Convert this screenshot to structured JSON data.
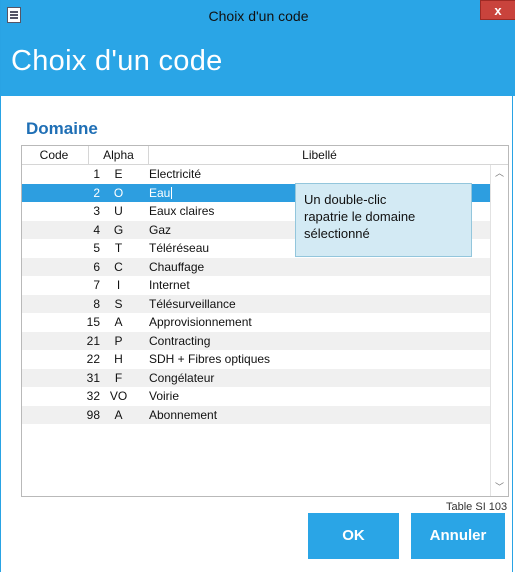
{
  "window": {
    "title": "Choix d'un code",
    "close_label": "x"
  },
  "header": {
    "title": "Choix d'un code"
  },
  "section": {
    "title": "Domaine"
  },
  "table": {
    "columns": [
      "Code",
      "Alpha",
      "Libellé"
    ],
    "selected_index": 1,
    "rows": [
      {
        "code": "1",
        "alpha": "E",
        "libelle": "Electricité"
      },
      {
        "code": "2",
        "alpha": "O",
        "libelle": "Eau"
      },
      {
        "code": "3",
        "alpha": "U",
        "libelle": "Eaux claires"
      },
      {
        "code": "4",
        "alpha": "G",
        "libelle": "Gaz"
      },
      {
        "code": "5",
        "alpha": "T",
        "libelle": "Téléréseau"
      },
      {
        "code": "6",
        "alpha": "C",
        "libelle": "Chauffage"
      },
      {
        "code": "7",
        "alpha": "I",
        "libelle": "Internet"
      },
      {
        "code": "8",
        "alpha": "S",
        "libelle": "Télésurveillance"
      },
      {
        "code": "15",
        "alpha": "A",
        "libelle": "Approvisionnement"
      },
      {
        "code": "21",
        "alpha": "P",
        "libelle": "Contracting"
      },
      {
        "code": "22",
        "alpha": "H",
        "libelle": "SDH + Fibres optiques"
      },
      {
        "code": "31",
        "alpha": "F",
        "libelle": "Congélateur"
      },
      {
        "code": "32",
        "alpha": "VO",
        "libelle": "Voirie"
      },
      {
        "code": "98",
        "alpha": "A",
        "libelle": "Abonnement"
      }
    ]
  },
  "tooltip": {
    "text_line1": "Un double-clic",
    "text_line2": "rapatrie le domaine",
    "text_line3": "sélectionné"
  },
  "footer": {
    "table_ref": "Table SI 103",
    "ok_label": "OK",
    "cancel_label": "Annuler"
  },
  "icons": {
    "app": "document-icon",
    "scroll_up": "chevron-up-icon",
    "scroll_down": "chevron-down-icon"
  },
  "colors": {
    "accent": "#2aa5e6",
    "section_title": "#1f6fb5",
    "selection": "#2d9ee0",
    "tooltip_bg": "#d3eaf4",
    "close": "#c9433c"
  }
}
